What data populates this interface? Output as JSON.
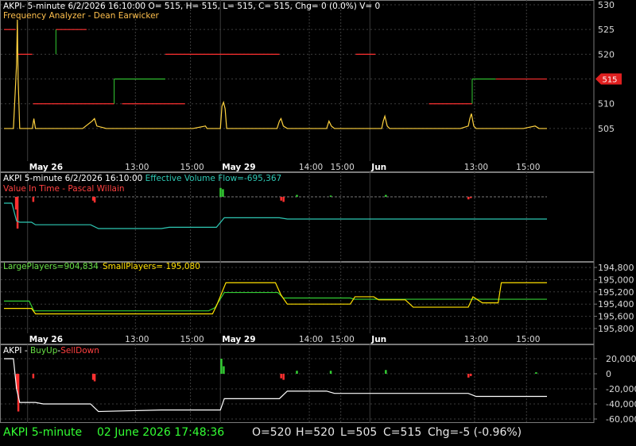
{
  "colors": {
    "background": "#000000",
    "grid": "#3c3c3c",
    "frame": "#7a7a7a",
    "axis_text": "#d8d8d8",
    "price_line": "#ffd23f",
    "red": "#ff3030",
    "green": "#33cc33",
    "cyan": "#2ec8b4",
    "white": "#ffffff",
    "label_orange": "#ffc04d",
    "label_green": "#66dd44",
    "label_yellow": "#ffe000",
    "label_red": "#ff4040",
    "status_green": "#33ff33",
    "status_white": "#e6e6e6",
    "price_tag": "#e02020"
  },
  "panel1": {
    "header": "AKPI- 5-minute 6/2/2026 16:10:00 O= 515, H= 515, L= 515, C= 515, Chg= 0 (0.0%) V= 0",
    "subtitle": "Frequency Analyzer - Dean Earwicker",
    "price_tag": "515"
  },
  "panel2": {
    "header_prefix": "AKPI 5-minute  6/2/2026 16:10:00",
    "header_indicator": "Effective Volume Flow=-695,367",
    "subtitle": "Value In Time - Pascal Willain"
  },
  "panel3": {
    "large_label": "LargePlayers=904,834",
    "small_label": "SmallPlayers= 195,080"
  },
  "panel4": {
    "header_prefix": "AKPI - ",
    "buy_label": "BuyUp",
    "sep": "-",
    "sell_label": "SellDown"
  },
  "status": {
    "symbol": "AKPI  5-minute",
    "datetime": "02 June 2026 17:48:36",
    "open": "O=520",
    "high": "H=520",
    "low": "L=505",
    "close": "C=515",
    "change": "Chg=-5 (-0.96%)"
  },
  "chart_data": [
    {
      "type": "line",
      "name": "price panel",
      "y_ticks": [
        "530",
        "525",
        "520",
        "515",
        "510",
        "505"
      ],
      "ylim": [
        500.5,
        530
      ],
      "x_labels": [
        "May 26",
        "13:00",
        "15:00",
        "May 29",
        "14:00",
        "15:00",
        "Jun",
        "13:00",
        "15:00"
      ],
      "x_range": [
        0,
        690
      ],
      "price_series": {
        "x": [
          0,
          12,
          16,
          17,
          18,
          20,
          30,
          36,
          38,
          40,
          60,
          100,
          112,
          115,
          118,
          130,
          200,
          240,
          256,
          258,
          260,
          275,
          277,
          279,
          281,
          283,
          300,
          347,
          350,
          352,
          355,
          360,
          380,
          410,
          413,
          416,
          420,
          440,
          480,
          482,
          484,
          487,
          490,
          520,
          560,
          580,
          590,
          592,
          594,
          597,
          600,
          620,
          660,
          675,
          680,
          690
        ],
        "y": [
          505,
          505,
          518,
          527,
          515,
          505,
          505,
          505,
          507,
          505,
          505,
          505,
          506.5,
          507,
          505.5,
          505,
          505,
          505,
          505.5,
          505,
          505,
          505,
          509.5,
          510.3,
          509,
          505,
          505,
          505,
          506.5,
          507,
          505.5,
          505,
          505,
          505,
          506.5,
          505.5,
          505,
          505,
          505,
          506.5,
          507.5,
          505.5,
          505,
          505,
          505,
          505,
          505.5,
          507,
          508,
          505.5,
          505,
          505,
          505,
          505.5,
          505,
          505
        ]
      },
      "frequency_levels": [
        {
          "from": 0,
          "to": 15,
          "value": 525,
          "color": "red"
        },
        {
          "from": 16,
          "to": 36,
          "value": 520,
          "color": "red"
        },
        {
          "from": 37,
          "to": 60,
          "value": 510,
          "color": "red"
        },
        {
          "from": 66,
          "to": 105,
          "value": 525,
          "color": "red"
        },
        {
          "from": 66,
          "to": 68,
          "value": 525,
          "to_value": 520,
          "color": "green"
        },
        {
          "from": 60,
          "to": 140,
          "value": 510,
          "color": "red"
        },
        {
          "from": 140,
          "to": 205,
          "value": 515,
          "color": "green"
        },
        {
          "from": 140,
          "to": 142,
          "value": 510,
          "to_value": 515,
          "color": "green"
        },
        {
          "from": 205,
          "to": 350,
          "value": 520,
          "color": "red"
        },
        {
          "from": 150,
          "to": 230,
          "value": 510,
          "color": "red"
        },
        {
          "from": 447,
          "to": 472,
          "value": 520,
          "color": "red"
        },
        {
          "from": 540,
          "to": 595,
          "value": 510,
          "color": "red"
        },
        {
          "from": 595,
          "to": 625,
          "value": 515,
          "color": "green"
        },
        {
          "from": 595,
          "to": 597,
          "value": 510,
          "to_value": 515,
          "color": "green"
        },
        {
          "from": 625,
          "to": 690,
          "value": 515,
          "color": "red"
        }
      ]
    },
    {
      "type": "line",
      "name": "volume flow panel",
      "ylim": [
        -80,
        20
      ],
      "effective_volume_flow": {
        "x": [
          0,
          10,
          16,
          20,
          35,
          40,
          110,
          120,
          200,
          210,
          270,
          280,
          350,
          360,
          690
        ],
        "y": [
          -10,
          -10,
          -38,
          -40,
          -40,
          -44,
          -44,
          -50,
          -50,
          -48,
          -48,
          -33,
          -33,
          -35,
          -35
        ]
      },
      "zero_line": 0,
      "bars": {
        "x": [
          15,
          17,
          37,
          113,
          115,
          275,
          278,
          352,
          355,
          372,
          415,
          485,
          590,
          593
        ],
        "y": [
          -20,
          -50,
          -8,
          -6,
          -9,
          14,
          12,
          -6,
          -8,
          3,
          2,
          3,
          -4,
          -2
        ]
      }
    },
    {
      "type": "line",
      "name": "players panel",
      "y_ticks": [
        "194,800",
        "195,000",
        "195,200",
        "195,400",
        "195,600",
        "195,800"
      ],
      "ylim": [
        195900,
        194700
      ],
      "large_players": {
        "x": [
          0,
          32,
          38,
          260,
          268,
          280,
          348,
          355,
          440,
          445,
          515,
          520,
          590,
          597,
          690
        ],
        "y": [
          195350,
          195350,
          195510,
          195510,
          195460,
          195210,
          195210,
          195300,
          195300,
          195320,
          195320,
          195320,
          195320,
          195320,
          195320
        ]
      },
      "small_players": {
        "x": [
          0,
          35,
          40,
          265,
          270,
          282,
          345,
          352,
          360,
          440,
          446,
          470,
          476,
          510,
          520,
          590,
          596,
          608,
          628,
          632,
          690
        ],
        "y": [
          195470,
          195470,
          195560,
          195560,
          195430,
          195050,
          195050,
          195250,
          195400,
          195400,
          195280,
          195280,
          195330,
          195330,
          195450,
          195450,
          195280,
          195380,
          195380,
          195050,
          195050
        ]
      },
      "x_labels": [
        "May 26",
        "13:00",
        "15:00",
        "May 29",
        "14:00",
        "15:00",
        "Jun",
        "13:00",
        "15:00"
      ]
    },
    {
      "type": "line",
      "name": "BuyUp-SellDown panel",
      "y_ticks": [
        "20,000",
        "0",
        "-20,000",
        "-40,000",
        "-60,000"
      ],
      "ylim": [
        -63000,
        30000
      ],
      "cumulative": {
        "x": [
          0,
          12,
          16,
          20,
          40,
          50,
          110,
          120,
          200,
          275,
          280,
          350,
          360,
          410,
          420,
          590,
          600,
          690
        ],
        "y": [
          20000,
          20000,
          -20000,
          -38000,
          -38000,
          -40000,
          -40000,
          -50000,
          -48000,
          -48000,
          -33000,
          -33000,
          -23000,
          -23000,
          -26000,
          -26000,
          -30000,
          -30000
        ]
      },
      "bars": {
        "x": [
          16,
          18,
          37,
          113,
          115,
          276,
          279,
          352,
          355,
          372,
          415,
          485,
          590,
          593,
          676
        ],
        "y": [
          -20000,
          -50000,
          -6000,
          -8000,
          -10000,
          20000,
          10000,
          -6000,
          -8000,
          4000,
          4000,
          5000,
          -5000,
          -3000,
          2000
        ]
      }
    }
  ]
}
